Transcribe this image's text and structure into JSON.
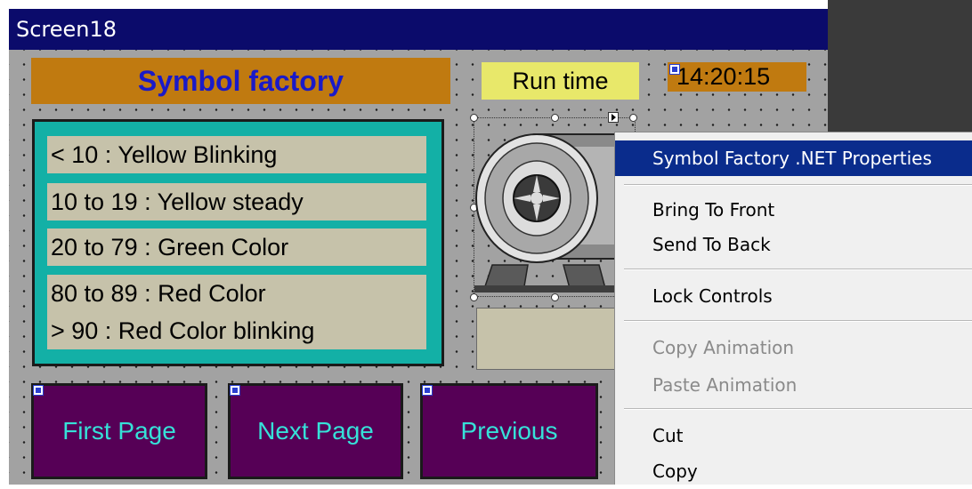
{
  "window": {
    "title": "Screen18"
  },
  "screen": {
    "header": "Symbol factory",
    "runtime_label": "Run time",
    "clock": "14:20:15",
    "legend": [
      "< 10 : Yellow Blinking",
      "10 to 19 : Yellow steady",
      "20 to 79 : Green Color",
      "80 to 89 : Red Color",
      "> 90 : Red Color blinking"
    ],
    "buttons": {
      "first": "First Page",
      "next": "Next Page",
      "previous": "Previous"
    }
  },
  "context_menu": {
    "items": [
      {
        "label": "Symbol Factory .NET Properties",
        "state": "highlighted"
      },
      {
        "label": "Bring To Front",
        "state": "enabled"
      },
      {
        "label": "Send To Back",
        "state": "enabled"
      },
      {
        "label": "Lock Controls",
        "state": "enabled"
      },
      {
        "label": "Copy Animation",
        "state": "disabled"
      },
      {
        "label": "Paste Animation",
        "state": "disabled"
      },
      {
        "label": "Cut",
        "state": "enabled"
      },
      {
        "label": "Copy",
        "state": "enabled"
      }
    ]
  },
  "colors": {
    "title_bar": "#0b0b6b",
    "header_bg": "#c07a10",
    "header_text": "#1a1ac8",
    "runtime_bg": "#e8e86a",
    "legend_panel": "#13b0a6",
    "legend_item": "#c6c2aa",
    "nav_button": "#560056",
    "nav_button_text": "#36e1d8",
    "menu_highlight": "#0a2c8c"
  },
  "icons": [
    "tag-marker-icon",
    "motor-pump-icon",
    "smart-tag-arrow-icon"
  ]
}
